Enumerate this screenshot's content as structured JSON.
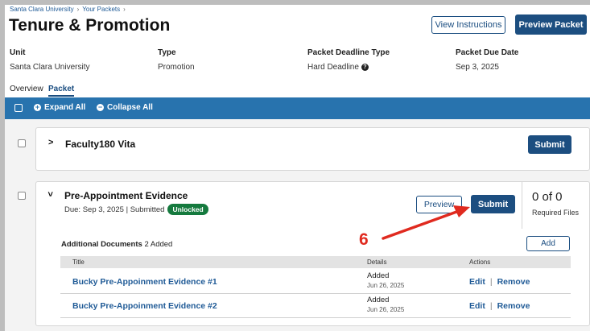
{
  "breadcrumb": [
    "Santa Clara University",
    "Your Packets"
  ],
  "page_title": "Tenure & Promotion",
  "header_buttons": {
    "view_instructions": "View Instructions",
    "preview_packet": "Preview Packet"
  },
  "meta": [
    {
      "label": "Unit",
      "value": "Santa Clara University"
    },
    {
      "label": "Type",
      "value": "Promotion"
    },
    {
      "label": "Packet Deadline Type",
      "value": "Hard Deadline"
    },
    {
      "label": "Packet Due Date",
      "value": "Sep 3, 2025"
    }
  ],
  "tabs": [
    "Overview",
    "Packet"
  ],
  "toolbar": {
    "expand_all": "Expand All",
    "collapse_all": "Collapse All"
  },
  "sections": [
    {
      "title": "Faculty180 Vita",
      "submit_label": "Submit"
    },
    {
      "title": "Pre-Appointment Evidence",
      "due_text": "Due: Sep 3, 2025 | Submitted",
      "badge": "Unlocked",
      "preview_label": "Preview",
      "submit_label": "Submit",
      "required_count": "0 of 0",
      "required_label": "Required Files",
      "additional_docs_label": "Additional Documents",
      "additional_docs_count": "2 Added",
      "add_label": "Add",
      "table": {
        "headers": [
          "Title",
          "Details",
          "Actions"
        ],
        "rows": [
          {
            "title": "Bucky Pre-Appoinment Evidence #1",
            "status": "Added",
            "date": "Jun 26, 2025",
            "edit": "Edit",
            "remove": "Remove"
          },
          {
            "title": "Bucky Pre-Appoinment Evidence #2",
            "status": "Added",
            "date": "Jun 26, 2025",
            "edit": "Edit",
            "remove": "Remove"
          }
        ]
      }
    }
  ],
  "annotation": {
    "step_number": "6",
    "color": "#e02a1f"
  },
  "colors": {
    "primary": "#1c4e80",
    "toolbar": "#2873ae",
    "badge": "#157a3e",
    "link": "#1f5a96"
  },
  "icons": {
    "deadline_help": "question-circle-icon",
    "expand": "plus-circle-icon",
    "collapse": "minus-circle-icon"
  }
}
